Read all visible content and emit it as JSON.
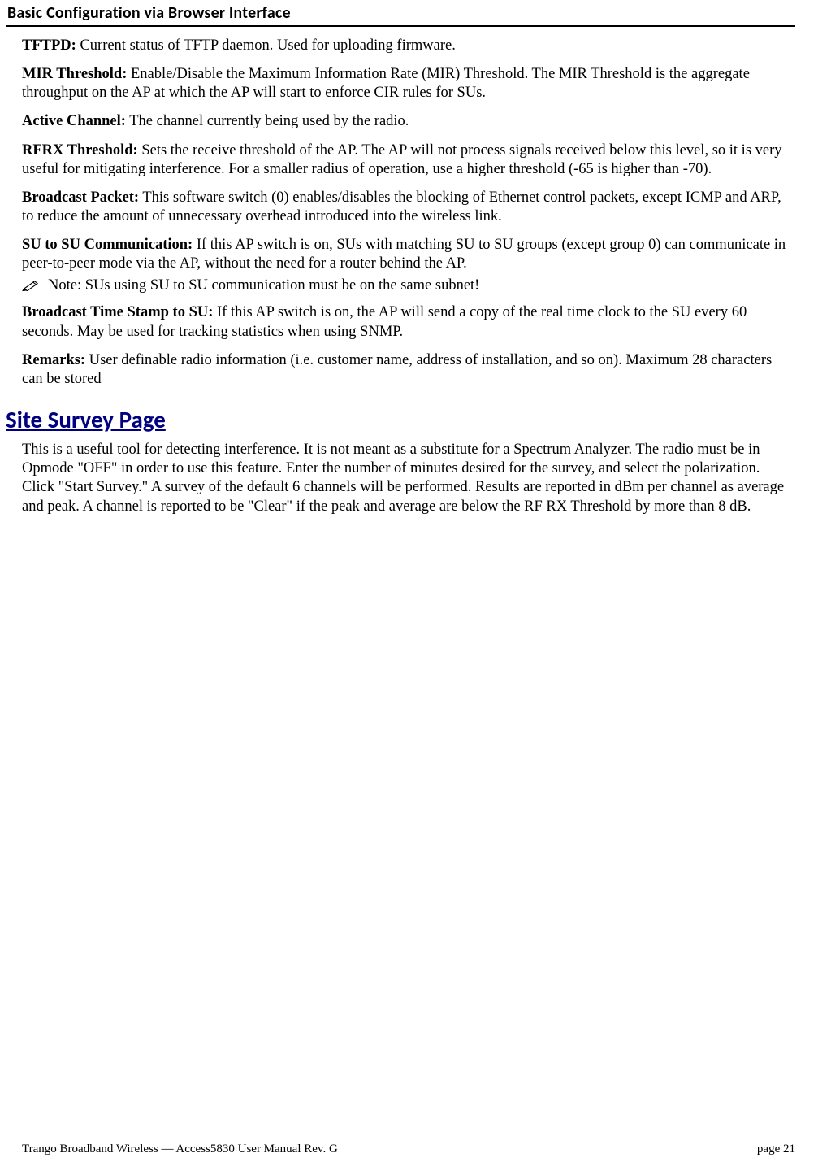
{
  "header": {
    "title": "Basic Configuration via Browser Interface"
  },
  "definitions": [
    {
      "term": "TFTPD:",
      "body": "  Current status of TFTP daemon.  Used for uploading firmware."
    },
    {
      "term": "MIR Threshold:",
      "body": "  Enable/Disable the Maximum Information Rate (MIR) Threshold.  The MIR Threshold is the aggregate throughput on the AP at which the AP will start to enforce CIR rules for SUs."
    },
    {
      "term": "Active Channel:",
      "body": "  The channel currently being used by the radio."
    },
    {
      "term": "RFRX Threshold:",
      "body": "  Sets the receive threshold of the AP. The AP will not process signals received below this level, so it is very useful for mitigating interference.  For a smaller radius of operation, use a higher threshold (-65 is higher than -70)."
    },
    {
      "term": "Broadcast Packet:",
      "body": "  This software switch (0) enables/disables the blocking of Ethernet control packets, except ICMP and ARP, to reduce the amount of unnecessary overhead introduced into the wireless link."
    },
    {
      "term": "SU to SU Communication:",
      "body": "  If this AP switch is on, SUs with matching SU to SU groups (except group 0) can communicate in peer-to-peer mode via the AP, without the need for a router behind the AP."
    }
  ],
  "note": {
    "label": "Note:",
    "text": " SUs using SU to SU communication must be on the same subnet!"
  },
  "definitions2": [
    {
      "term": "Broadcast Time Stamp to SU:",
      "body": "  If this AP switch is on, the AP will send a copy of the real time clock to the SU every 60 seconds.  May be used for tracking statistics when using SNMP."
    },
    {
      "term": "Remarks:",
      "body": "  User definable radio information (i.e. customer name, address of installation, and so on).  Maximum 28 characters can be stored"
    }
  ],
  "section_heading": "Site Survey Page",
  "section_body": "This is a useful tool for detecting interference.  It is not meant as a substitute for a Spectrum Analyzer.  The radio must be in Opmode \"OFF\" in order to use this feature.  Enter the number of minutes desired for the survey, and select the polarization. Click \"Start Survey.\"  A survey of the default 6 channels will be performed. Results are reported in dBm per channel as average and peak.  A channel is reported to be \"Clear\" if the peak and average are below the RF RX Threshold by more than 8 dB.",
  "footer": {
    "left": "Trango Broadband Wireless — Access5830 User Manual  Rev. G",
    "right": "page 21"
  }
}
